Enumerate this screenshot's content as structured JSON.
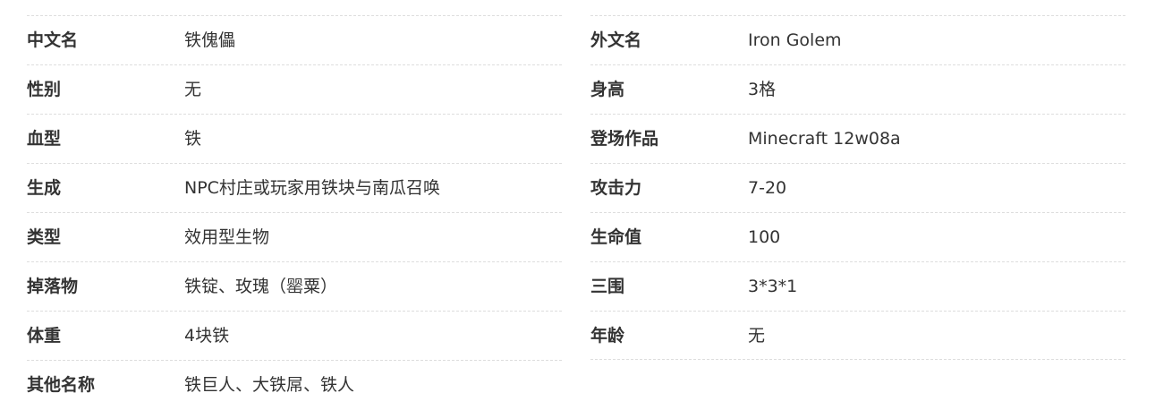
{
  "left": [
    {
      "label": "中文名",
      "value": "铁傀儡"
    },
    {
      "label": "性别",
      "value": "无"
    },
    {
      "label": "血型",
      "value": "铁"
    },
    {
      "label": "生成",
      "value": "NPC村庄或玩家用铁块与南瓜召唤"
    },
    {
      "label": "类型",
      "value": "效用型生物"
    },
    {
      "label": "掉落物",
      "value": "铁锭、玫瑰（罂粟）"
    },
    {
      "label": "体重",
      "value": "4块铁"
    },
    {
      "label": "其他名称",
      "value": "铁巨人、大铁屌、铁人"
    }
  ],
  "right": [
    {
      "label": "外文名",
      "value": "Iron Golem"
    },
    {
      "label": "身高",
      "value": "3格"
    },
    {
      "label": "登场作品",
      "value": "Minecraft 12w08a"
    },
    {
      "label": "攻击力",
      "value": "7-20"
    },
    {
      "label": "生命值",
      "value": "100"
    },
    {
      "label": "三围",
      "value": "3*3*1"
    },
    {
      "label": "年龄",
      "value": "无"
    }
  ]
}
